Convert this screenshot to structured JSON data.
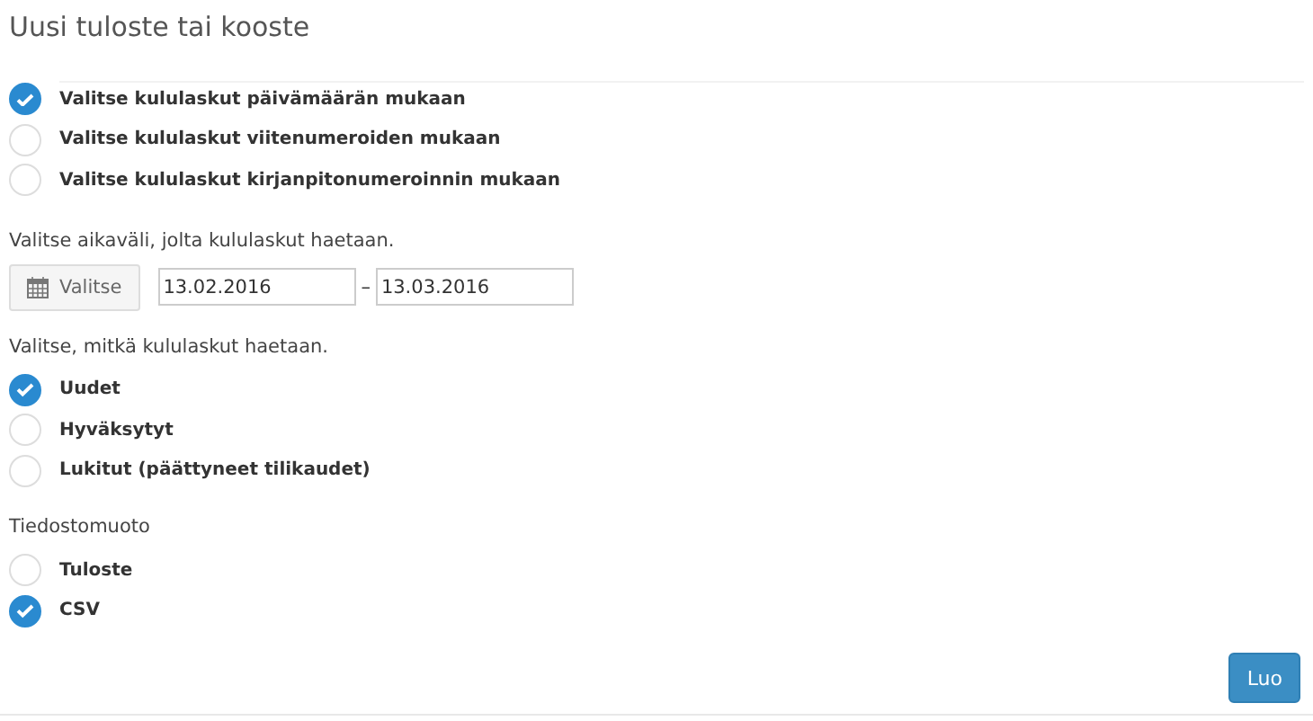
{
  "title": "Uusi tuloste tai kooste",
  "sections": [
    {
      "kind": "choices",
      "options": [
        {
          "label": "Valitse kululaskut päivämäärän mukaan",
          "selected": true
        },
        {
          "label": "Valitse kululaskut viitenumeroiden mukaan",
          "selected": false
        },
        {
          "label": "Valitse kululaskut kirjanpitonumeroinnin mukaan",
          "selected": false
        }
      ]
    },
    {
      "kind": "date-range",
      "label": "Valitse aikaväli, jolta kululaskut haetaan.",
      "button": "Valitse",
      "from": "13.02.2016",
      "separator": "–",
      "to": "13.03.2016"
    },
    {
      "kind": "choices",
      "label": "Valitse, mitkä kululaskut haetaan.",
      "options": [
        {
          "label": "Uudet",
          "selected": true
        },
        {
          "label": "Hyväksytyt",
          "selected": false
        },
        {
          "label": "Lukitut (päättyneet tilikaudet)",
          "selected": false
        }
      ]
    },
    {
      "kind": "choices",
      "label": "Tiedostomuoto",
      "options": [
        {
          "label": "Tuloste",
          "selected": false
        },
        {
          "label": "CSV",
          "selected": true
        }
      ]
    }
  ],
  "submit": "Luo"
}
